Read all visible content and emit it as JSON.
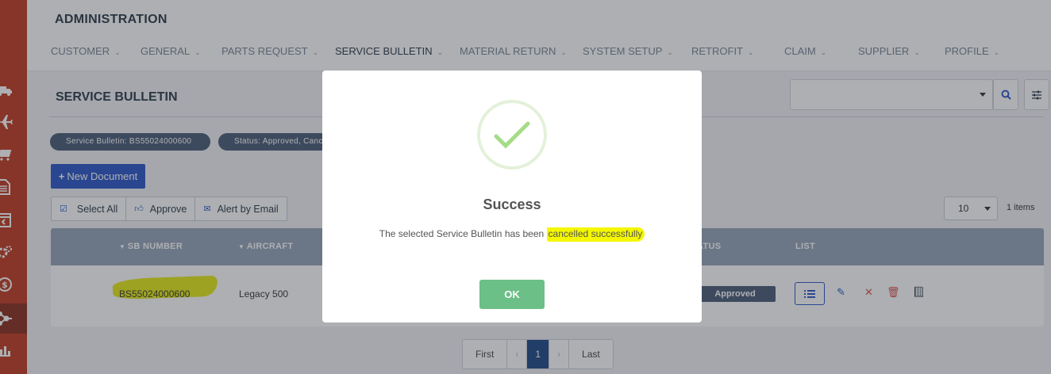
{
  "header": {
    "title": "ADMINISTRATION",
    "nav": [
      {
        "label": "CUSTOMER"
      },
      {
        "label": "GENERAL"
      },
      {
        "label": "PARTS REQUEST"
      },
      {
        "label": "SERVICE BULLETIN",
        "active": true
      },
      {
        "label": "MATERIAL RETURN"
      },
      {
        "label": "SYSTEM SETUP"
      },
      {
        "label": "RETROFIT"
      },
      {
        "label": "CLAIM"
      },
      {
        "label": "SUPPLIER"
      },
      {
        "label": "PROFILE"
      }
    ]
  },
  "sidebar": {
    "icons": [
      "truck-icon",
      "plane-icon",
      "cart-icon",
      "document-icon",
      "return-box-icon",
      "gears-icon",
      "money-icon",
      "network-icon",
      "bar-chart-icon"
    ],
    "active": "network-icon"
  },
  "page": {
    "title": "SERVICE BULLETIN",
    "filters": [
      "Service Bulletin: BS55024000600",
      "Status: Approved, Canc"
    ],
    "new_document_label": "New Document",
    "actions": {
      "select_all": "Select All",
      "approve": "Approve",
      "alert_by_email": "Alert by Email"
    },
    "page_size": "10",
    "items_count": "1 items"
  },
  "table": {
    "headers": {
      "sb_number": "SB NUMBER",
      "aircraft": "AIRCRAFT",
      "status": "ATUS",
      "list": "LIST"
    },
    "rows": [
      {
        "sb_number": "BS55024000600",
        "aircraft": "Legacy 500",
        "status": "Approved"
      }
    ]
  },
  "pagination": {
    "first": "First",
    "prev": "‹",
    "current": "1",
    "next": "›",
    "last": "Last"
  },
  "modal": {
    "title": "Success",
    "message_prefix": "The selected Service Bulletin has been ",
    "message_highlight": "cancelled successfully",
    "ok_label": "OK"
  },
  "colors": {
    "sidebar": "#c23b22",
    "primary": "#2c56c8",
    "table_header": "#95a3b8",
    "ok_button": "#6cbf86",
    "highlight": "#f4f700"
  }
}
